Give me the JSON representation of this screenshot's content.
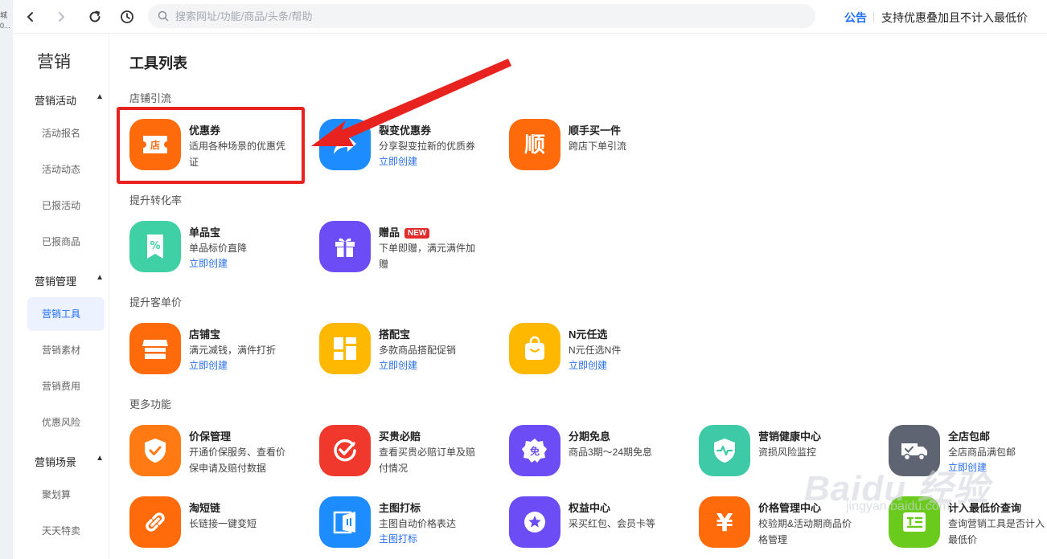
{
  "leftstrip": {
    "line1": "城",
    "line2": "0..."
  },
  "topbar": {
    "search_placeholder": "搜索网址/功能/商品/头条/帮助",
    "notice_tag": "公告",
    "notice_text": "支持优惠叠加且不计入最低价"
  },
  "sidebar": {
    "title": "营销",
    "groups": [
      {
        "label": "营销活动",
        "items": [
          "活动报名",
          "活动动态",
          "已报活动",
          "已报商品"
        ]
      },
      {
        "label": "营销管理",
        "items": [
          "营销工具",
          "营销素材",
          "营销费用",
          "优惠风险"
        ]
      },
      {
        "label": "营销场景",
        "items": [
          "聚划算",
          "天天特卖"
        ]
      }
    ],
    "active_item": "营销工具"
  },
  "main": {
    "page_title": "工具列表",
    "sections": [
      {
        "title": "店铺引流",
        "tools": [
          {
            "name": "优惠券",
            "desc": "适用各种场景的优惠凭证",
            "link": "",
            "icon": "store-ticket-icon"
          },
          {
            "name": "裂变优惠券",
            "desc": "分享裂变拉新的优质券",
            "link": "立即创建",
            "icon": "share-arrow-icon"
          },
          {
            "name": "顺手买一件",
            "desc": "跨店下单引流",
            "link": "",
            "icon": "shun-char-icon"
          }
        ]
      },
      {
        "title": "提升转化率",
        "tools": [
          {
            "name": "单品宝",
            "desc": "单品标价直降",
            "link": "立即创建",
            "icon": "percent-tag-icon"
          },
          {
            "name": "赠品",
            "badge": "NEW",
            "desc": "下单即赠，满元满件加赠",
            "link": "",
            "icon": "gift-icon"
          }
        ]
      },
      {
        "title": "提升客单价",
        "tools": [
          {
            "name": "店铺宝",
            "desc": "满元减钱，满件打折",
            "link": "立即创建",
            "icon": "storefront-icon"
          },
          {
            "name": "搭配宝",
            "desc": "多款商品搭配促销",
            "link": "立即创建",
            "icon": "grid-layout-icon"
          },
          {
            "name": "N元任选",
            "desc": "N元任选N件",
            "link": "立即创建",
            "icon": "shopping-bag-icon"
          }
        ]
      },
      {
        "title": "更多功能",
        "tools": [
          {
            "name": "价保管理",
            "desc": "开通价保服务、查看价保申请及赔付数据",
            "link": "",
            "icon": "shield-check-icon"
          },
          {
            "name": "买贵必赔",
            "desc": "查看买贵必赔订单及赔付情况",
            "link": "",
            "icon": "check-circle-icon"
          },
          {
            "name": "分期免息",
            "desc": "商品3期～24期免息",
            "link": "",
            "icon": "free-badge-icon"
          },
          {
            "name": "营销健康中心",
            "desc": "资损风险监控",
            "link": "",
            "icon": "shield-pulse-icon"
          },
          {
            "name": "全店包邮",
            "desc": "全店商品满包邮",
            "link": "立即创建",
            "icon": "delivery-truck-icon"
          },
          {
            "name": "淘短链",
            "desc": "长链接一键变短",
            "link": "",
            "icon": "link-icon"
          },
          {
            "name": "主图打标",
            "desc": "主图自动价格表达",
            "link": "主图打标",
            "icon": "image-tag-icon"
          },
          {
            "name": "权益中心",
            "desc": "采买红包、会员卡等",
            "link": "",
            "icon": "star-badge-icon"
          },
          {
            "name": "价格管理中心",
            "desc": "校验期&活动期商品价格管理",
            "link": "",
            "icon": "yen-icon"
          },
          {
            "name": "计入最低价查询",
            "desc": "查询营销工具是否计入最低价",
            "link": "",
            "icon": "price-query-icon"
          }
        ]
      }
    ]
  },
  "watermark": {
    "brand": "Baidu 经验",
    "sub": "jingyan.baidu.com"
  },
  "colors": {
    "accent": "#1f6fff",
    "orange": "#ff6a0a",
    "blue": "#1d8cff",
    "green": "#3fd0a6",
    "purple": "#6b4cf5",
    "yellow": "#ffb800",
    "red": "#f0382c",
    "teal": "#3ec9a7",
    "gray": "#5e6471",
    "lime": "#6acb1d",
    "highlight": "#e8231f"
  }
}
